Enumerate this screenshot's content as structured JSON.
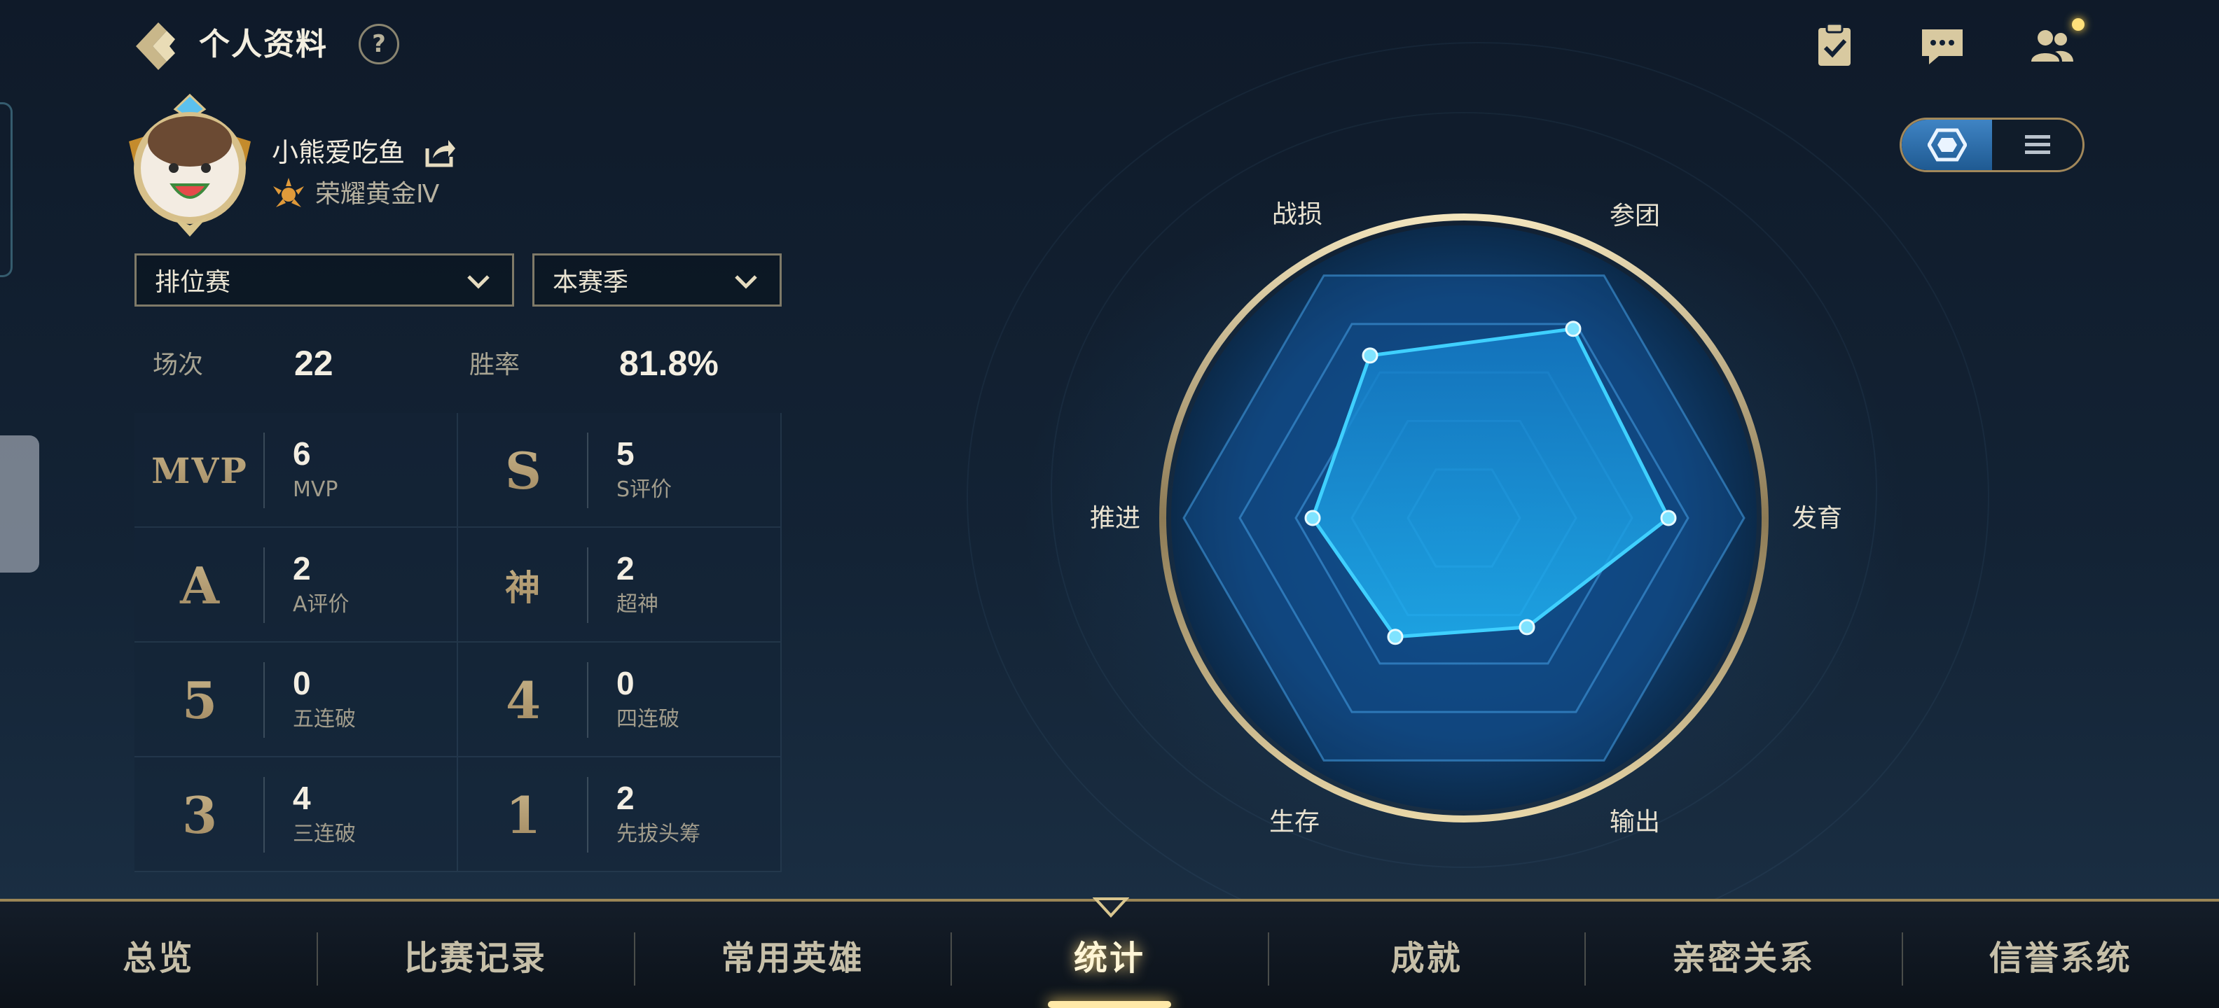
{
  "header": {
    "title": "个人资料",
    "help": "?"
  },
  "profile": {
    "name": "小熊爱吃鱼",
    "rank": "荣耀黄金Ⅳ"
  },
  "filters": {
    "mode": "排位赛",
    "season": "本赛季"
  },
  "summary": {
    "matches_label": "场次",
    "matches_value": "22",
    "winrate_label": "胜率",
    "winrate_value": "81.8%"
  },
  "stats": [
    {
      "badge": "MVP",
      "value": "6",
      "label": "MVP"
    },
    {
      "badge": "S",
      "value": "5",
      "label": "S评价"
    },
    {
      "badge": "A",
      "value": "2",
      "label": "A评价"
    },
    {
      "badge": "神",
      "value": "2",
      "label": "超神"
    },
    {
      "badge": "5",
      "value": "0",
      "label": "五连破"
    },
    {
      "badge": "4",
      "value": "0",
      "label": "四连破"
    },
    {
      "badge": "3",
      "value": "4",
      "label": "三连破"
    },
    {
      "badge": "1",
      "value": "2",
      "label": "先拔头筹"
    }
  ],
  "radar": {
    "axes": [
      "参团",
      "发育",
      "输出",
      "生存",
      "推进",
      "战损"
    ],
    "values": [
      0.78,
      0.73,
      0.45,
      0.49,
      0.54,
      0.67
    ],
    "colors": {
      "fill": "#19a0e6",
      "stroke": "#38c8ff",
      "ring": "#c9b78a"
    }
  },
  "top_icons": [
    "task-icon",
    "chat-icon",
    "friends-icon"
  ],
  "view_toggle": {
    "active": "radar"
  },
  "nav": {
    "items": [
      "总览",
      "比赛记录",
      "常用英雄",
      "统计",
      "成就",
      "亲密关系",
      "信誉系统"
    ],
    "active_index": 3
  },
  "theme": {
    "gold": "#c9b78a",
    "accent_blue": "#2f8fd8"
  }
}
